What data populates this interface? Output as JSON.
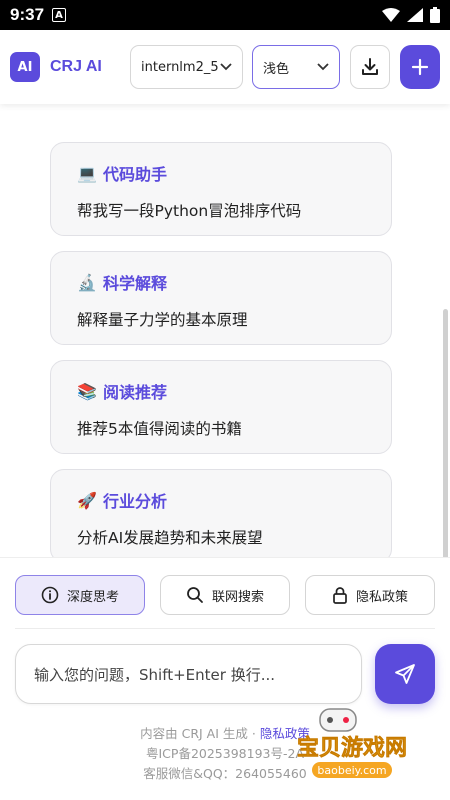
{
  "status": {
    "time": "9:37",
    "notif_icon": "A"
  },
  "header": {
    "logo_text": "AI",
    "brand": "CRJ AI",
    "model_select": "internlm2_5",
    "theme_select": "浅色"
  },
  "cards": [
    {
      "emoji": "💻",
      "title": "代码助手",
      "desc": "帮我写一段Python冒泡排序代码"
    },
    {
      "emoji": "🔬",
      "title": "科学解释",
      "desc": "解释量子力学的基本原理"
    },
    {
      "emoji": "📚",
      "title": "阅读推荐",
      "desc": "推荐5本值得阅读的书籍"
    },
    {
      "emoji": "🚀",
      "title": "行业分析",
      "desc": "分析AI发展趋势和未来展望"
    }
  ],
  "options": {
    "deep_think": "深度思考",
    "web_search": "联网搜索",
    "privacy": "隐私政策"
  },
  "input": {
    "placeholder": "输入您的问题，Shift+Enter 换行..."
  },
  "footer": {
    "line1_prefix": "内容由 CRJ AI 生成 · ",
    "line1_link": "隐私政策",
    "line2": "粤ICP备2025398193号-2A",
    "line3": "客服微信&QQ：264055460"
  },
  "watermark": {
    "text": "宝贝游戏网",
    "url": "baobeiy.com"
  },
  "colors": {
    "accent": "#5b4bdc",
    "accent_light": "#ece9fb"
  }
}
